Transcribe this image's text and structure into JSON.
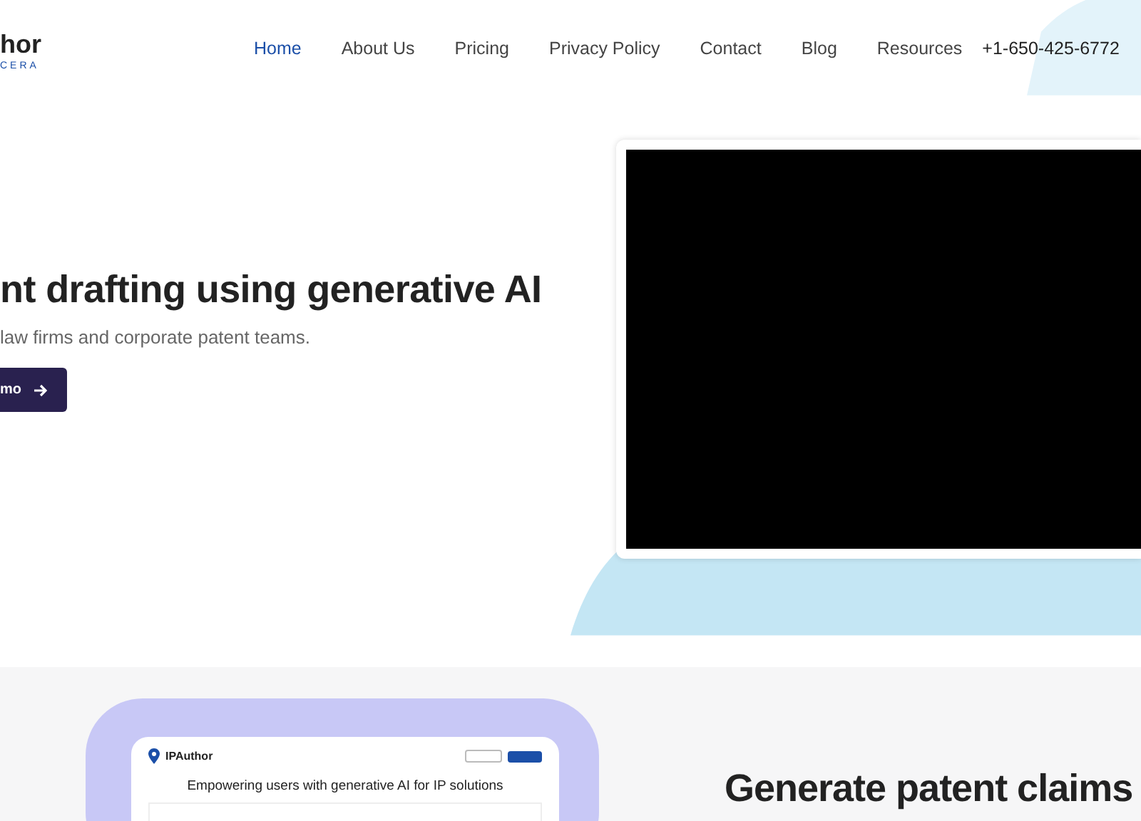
{
  "header": {
    "logo": {
      "name": "hor",
      "tagline": "CERA"
    },
    "nav": [
      {
        "label": "Home",
        "selected": true
      },
      {
        "label": "About Us",
        "selected": false
      },
      {
        "label": "Pricing",
        "selected": false
      },
      {
        "label": "Privacy Policy",
        "selected": false
      },
      {
        "label": "Contact",
        "selected": false
      },
      {
        "label": "Blog",
        "selected": false
      },
      {
        "label": "Resources",
        "selected": false
      }
    ],
    "phone": "+1-650-425-6772"
  },
  "hero": {
    "headline": "nt drafting using generative AI",
    "subtitle": "law firms and corporate patent teams.",
    "button": "mo"
  },
  "feature": {
    "app": {
      "brand": "IPAuthor",
      "heading": "Empowering users with generative AI for IP solutions"
    },
    "title": "Generate patent claims"
  }
}
